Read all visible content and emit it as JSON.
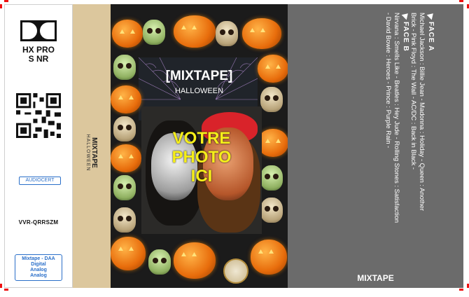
{
  "left_panel": {
    "noise_reduction": [
      "HX PRO",
      "S NR"
    ],
    "audiocert_label": "AUDIOCERT",
    "code": "VVR-QRRSZM",
    "format_lines": [
      "Mixtape - DAA",
      "Digital",
      "Analog",
      "Analog"
    ]
  },
  "spine": {
    "title": "MIXTAPE",
    "subtitle": "HALLOWEEN"
  },
  "cover": {
    "title": "[MIXTAPE]",
    "subtitle": "HALLOWEEN",
    "photo_placeholder": [
      "VOTRE",
      "PHOTO",
      "ICI"
    ]
  },
  "back": {
    "face_a_label": "FACE A",
    "face_a_lines": [
      "Michael Jackson : Billie Jean - Madonna : Holiday - Queen : Another",
      "Brick - Pink Floyd : The Wall - AC/DC : Back in Black -"
    ],
    "face_b_label": "FACE B",
    "face_b_lines": [
      "Nirvana : Smells Like - Beatles : Hey Jude - Rolling Stones : Satisfaction",
      "- David Bowie : Heroes - Prince : Purple Rain -"
    ],
    "brand": "MIXTAPE"
  },
  "colors": {
    "spine": "#dcc79d",
    "back": "#6b6b6b",
    "photo_text": "#f5ee1a",
    "accent_blue": "#2a6fc9",
    "crop_marks": "#e11111"
  }
}
